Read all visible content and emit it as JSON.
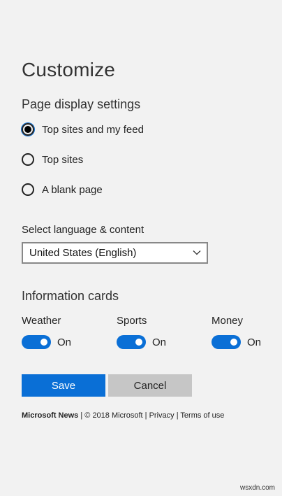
{
  "title": "Customize",
  "page_display": {
    "heading": "Page display settings",
    "options": [
      {
        "label": "Top sites and my feed",
        "checked": true
      },
      {
        "label": "Top sites",
        "checked": false
      },
      {
        "label": "A blank page",
        "checked": false
      }
    ]
  },
  "language": {
    "label": "Select language & content",
    "selected": "United States (English)"
  },
  "info_cards": {
    "heading": "Information cards",
    "cards": [
      {
        "name": "Weather",
        "state": "On",
        "on": true
      },
      {
        "name": "Sports",
        "state": "On",
        "on": true
      },
      {
        "name": "Money",
        "state": "On",
        "on": true
      }
    ]
  },
  "buttons": {
    "save": "Save",
    "cancel": "Cancel"
  },
  "footer": {
    "brand": "Microsoft News",
    "sep1": " | ",
    "copyright": "© 2018 Microsoft",
    "sep2": " | ",
    "privacy": "Privacy",
    "sep3": " | ",
    "terms": "Terms of use"
  },
  "watermark": "wsxdn.com",
  "colors": {
    "accent": "#0a6fd6",
    "background": "#f2f2f2",
    "cancel": "#c6c6c6"
  }
}
